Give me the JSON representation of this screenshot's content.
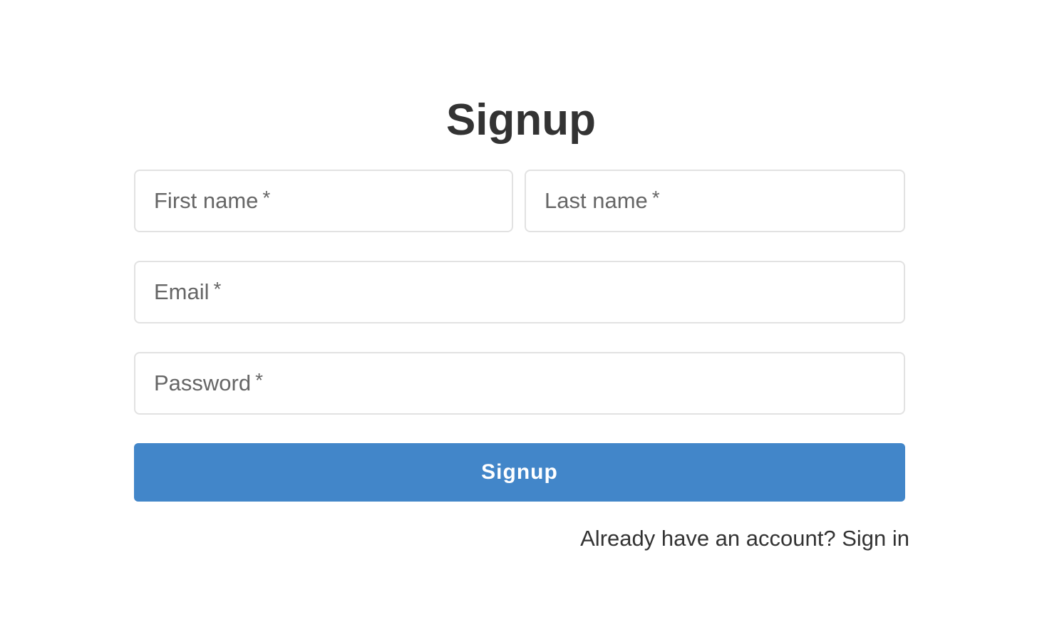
{
  "title": "Signup",
  "fields": {
    "first_name": {
      "label": "First name",
      "required_mark": "*"
    },
    "last_name": {
      "label": "Last name",
      "required_mark": "*"
    },
    "email": {
      "label": "Email",
      "required_mark": "*"
    },
    "password": {
      "label": "Password",
      "required_mark": "*"
    }
  },
  "submit_label": "Signup",
  "signin_link": "Already have an account? Sign in",
  "colors": {
    "primary": "#4286c9",
    "text": "#333333",
    "field_label": "#666666",
    "field_border": "#e2e2e2",
    "background": "#ffffff"
  }
}
